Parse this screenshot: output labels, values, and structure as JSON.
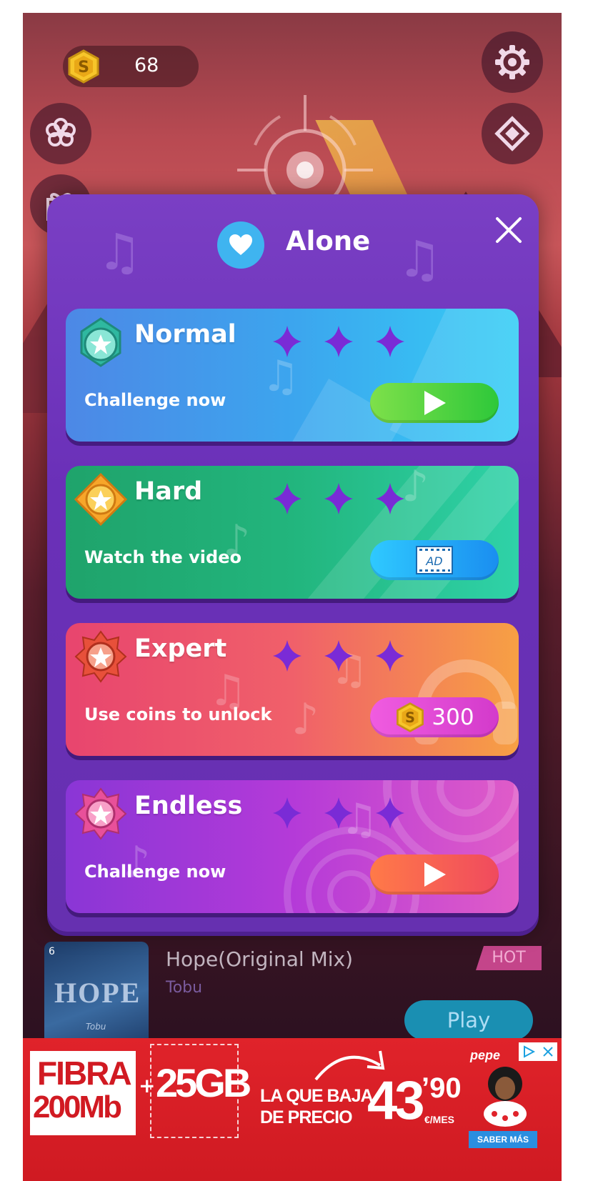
{
  "topbar": {
    "coin_count": "68",
    "coin_symbol": "S"
  },
  "popup": {
    "title": "Alone",
    "close_icon": "close-icon",
    "modes": [
      {
        "name": "Normal",
        "description": "Challenge now",
        "action": "play",
        "stars": 3,
        "color": "#3ca5ee"
      },
      {
        "name": "Hard",
        "description": "Watch the video",
        "action": "ad",
        "ad_label": "AD",
        "stars": 3,
        "color": "#22b57d"
      },
      {
        "name": "Expert",
        "description": "Use coins to unlock",
        "action": "coins",
        "price": "300",
        "coin_symbol": "S",
        "stars": 3,
        "color": "#f0606a"
      },
      {
        "name": "Endless",
        "description": "Challenge now",
        "action": "play",
        "stars": 3,
        "color": "#b43ad8"
      }
    ]
  },
  "song": {
    "rank": "6",
    "title": "Hope(Original Mix)",
    "artist": "Tobu",
    "tag": "HOT",
    "play_label": "Play"
  },
  "ad": {
    "fibra_line1": "FIBRA",
    "fibra_line2": "200Mb",
    "plus": "+",
    "gb": "25GB",
    "baja_line1": "LA QUE BAJA",
    "baja_line2": "DE PRECIO",
    "price_main": "43",
    "price_cents": "’90",
    "price_unit": "€/MES",
    "brand": "pepe",
    "cta": "SABER MÁS"
  },
  "colors": {
    "popup_bg": "#6a30b8",
    "star": "#7a2bd6",
    "accent_blue": "#3fb4f0"
  }
}
